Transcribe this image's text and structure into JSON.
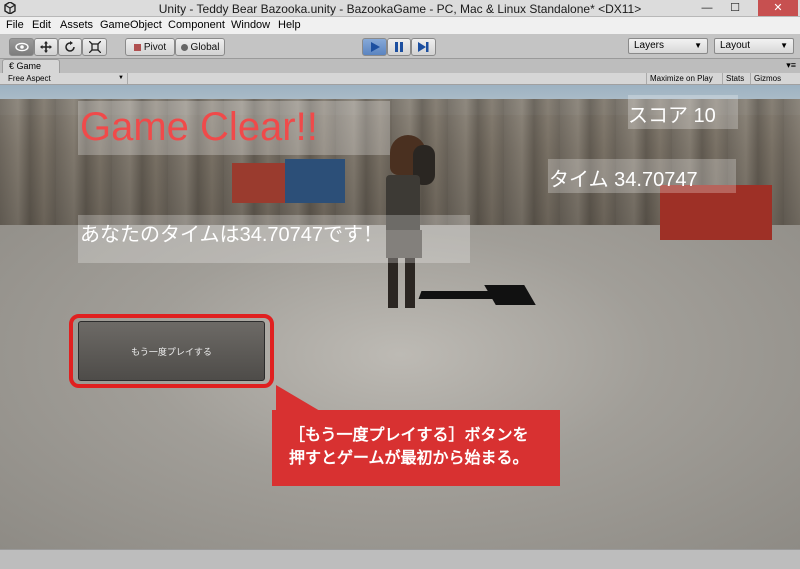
{
  "window": {
    "title": "Unity - Teddy Bear Bazooka.unity - BazookaGame - PC, Mac & Linux Standalone* <DX11>",
    "minimize": "—",
    "maximize": "☐",
    "close": "✕"
  },
  "menu": [
    "File",
    "Edit",
    "Assets",
    "GameObject",
    "Component",
    "Window",
    "Help"
  ],
  "toolbar": {
    "pivot": "Pivot",
    "global": "Global",
    "layers": "Layers",
    "layout": "Layout"
  },
  "game_tab": {
    "label": "Game",
    "aspect": "Free Aspect",
    "maximize_on_play": "Maximize on Play",
    "stats": "Stats",
    "gizmos": "Gizmos"
  },
  "hud": {
    "game_clear": "Game Clear!!",
    "score": "スコア 10",
    "time": "タイム 34.70747",
    "result": "あなたのタイムは34.70747です！",
    "retry_button": "もう一度プレイする"
  },
  "callout": {
    "line1": "［もう一度プレイする］ボタンを",
    "line2": "押すとゲームが最初から始まる。"
  },
  "colors": {
    "callout_red": "#d83131",
    "game_clear_red": "#f04a4a",
    "play_blue": "#5b84c0"
  }
}
